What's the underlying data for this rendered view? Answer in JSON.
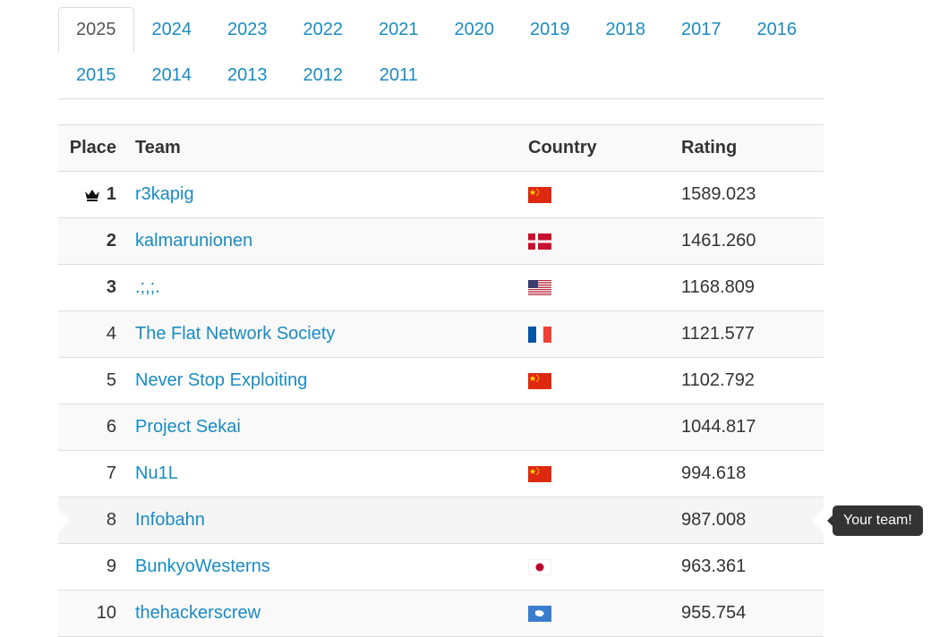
{
  "years": {
    "active": "2025",
    "items": [
      "2025",
      "2024",
      "2023",
      "2022",
      "2021",
      "2020",
      "2019",
      "2018",
      "2017",
      "2016",
      "2015",
      "2014",
      "2013",
      "2012",
      "2011"
    ]
  },
  "table": {
    "headers": {
      "place": "Place",
      "team": "Team",
      "country": "Country",
      "rating": "Rating"
    },
    "rows": [
      {
        "place": "1",
        "team": "r3kapig",
        "flag": "cn",
        "rating": "1589.023",
        "crown": true
      },
      {
        "place": "2",
        "team": "kalmarunionen",
        "flag": "dk",
        "rating": "1461.260"
      },
      {
        "place": "3",
        "team": ".;,;.",
        "flag": "us",
        "rating": "1168.809"
      },
      {
        "place": "4",
        "team": "The Flat Network Society",
        "flag": "fr",
        "rating": "1121.577"
      },
      {
        "place": "5",
        "team": "Never Stop Exploiting",
        "flag": "cn",
        "rating": "1102.792"
      },
      {
        "place": "6",
        "team": "Project Sekai",
        "flag": "",
        "rating": "1044.817"
      },
      {
        "place": "7",
        "team": "Nu1L",
        "flag": "cn",
        "rating": "994.618"
      },
      {
        "place": "8",
        "team": "Infobahn",
        "flag": "",
        "rating": "987.008",
        "mine": true
      },
      {
        "place": "9",
        "team": "BunkyoWesterns",
        "flag": "jp",
        "rating": "963.361"
      },
      {
        "place": "10",
        "team": "thehackerscrew",
        "flag": "aq",
        "rating": "955.754"
      }
    ]
  },
  "tooltip": {
    "text": "Your team!"
  },
  "colors": {
    "link": "#1a8bc0",
    "border": "#dddddd",
    "stripe": "#f9f9f9",
    "tooltip_bg": "#333333"
  }
}
